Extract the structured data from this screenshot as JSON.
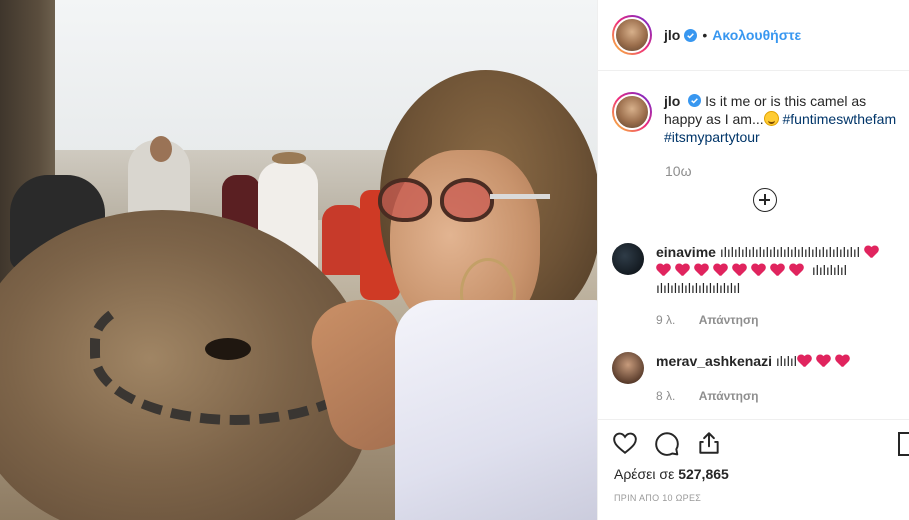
{
  "post": {
    "username": "jlo",
    "follow_label": "Ακολουθήστε",
    "caption_text": "Is it me or is this camel as happy as I am...",
    "hashtags": [
      "#funtimeswthefam",
      "#itsmypartytour"
    ],
    "caption_time": "10ω",
    "likes_label": "Αρέσει σε",
    "likes_count": "527,865",
    "posted_time": "ΠΡΙΝ ΑΠΟ 10 ΩΡΕΣ"
  },
  "comments": [
    {
      "username": "einavime",
      "text_a": "ılılılılılılılılılılılılılılılılılılılıl",
      "hearts": 9,
      "text_b": "ılılılılıl ılılılılılılılılılılılıl",
      "time": "9 λ.",
      "reply_label": "Απάντηση"
    },
    {
      "username": "merav_ashkenazi",
      "text_a": "ılılıl",
      "hearts": 3,
      "time": "8 λ.",
      "reply_label": "Απάντηση"
    }
  ],
  "colors": {
    "link": "#3897f0",
    "hashtag": "#003569",
    "verified": "#3897f0",
    "meta": "#8e8e8e"
  }
}
